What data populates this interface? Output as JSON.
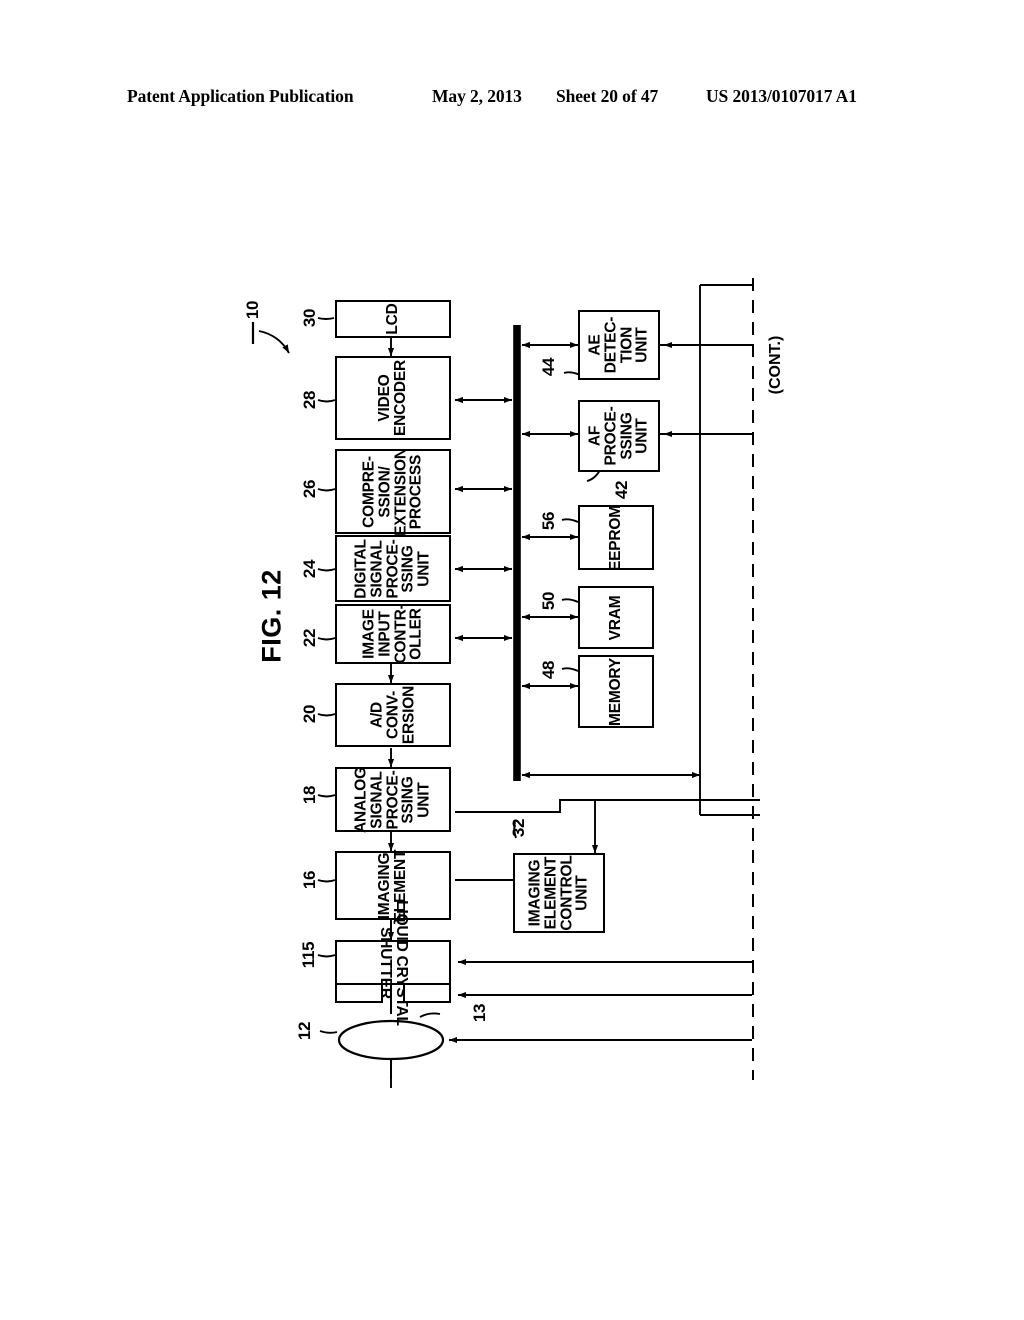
{
  "header": {
    "publication": "Patent Application Publication",
    "date": "May 2, 2013",
    "sheet": "Sheet 20 of 47",
    "doc_number": "US 2013/0107017 A1"
  },
  "figure": {
    "title": "FIG. 12",
    "system_ref": "10",
    "continuation_label": "(CONT.)"
  },
  "blocks": {
    "lcd": {
      "label": "LCD",
      "ref": "30"
    },
    "video_encoder": {
      "label": "VIDEO\nENCODER",
      "ref": "28"
    },
    "compression": {
      "label": "COMPRE-\nSSION/\nEXTENSION\nPROCESS",
      "ref": "26"
    },
    "digital_signal": {
      "label": "DIGITAL\nSIGNAL\nPROCE-\nSSING\nUNIT",
      "ref": "24"
    },
    "image_input": {
      "label": "IMAGE\nINPUT\nCONTR-\nOLLER",
      "ref": "22"
    },
    "ad_conversion": {
      "label": "A/D\nCONV-\nERSION",
      "ref": "20"
    },
    "analog_signal": {
      "label": "ANALOG\nSIGNAL\nPROCE-\nSSING\nUNIT",
      "ref": "18"
    },
    "imaging_element": {
      "label": "IMAGING\nELEMENT",
      "ref": "16"
    },
    "lc_shutter": {
      "label": "LIQUID CRYSTAL\nSHUTTER",
      "ref": "115"
    },
    "lens": {
      "label": "",
      "ref": "12"
    },
    "lens_link": {
      "label": "",
      "ref": "13"
    },
    "ie_control": {
      "label": "IMAGING\nELEMENT\nCONTROL\nUNIT",
      "ref": "32"
    },
    "ae_detection": {
      "label": "AE\nDETEC-\nTION\nUNIT",
      "ref": "44"
    },
    "af_processing": {
      "label": "AF\nPROCE-\nSSING\nUNIT",
      "ref": "42"
    },
    "eeprom": {
      "label": "EEPROM",
      "ref": "56"
    },
    "vram": {
      "label": "VRAM",
      "ref": "50"
    },
    "memory": {
      "label": "MEMORY",
      "ref": "48"
    }
  },
  "colors": {
    "ink": "#000000",
    "paper": "#ffffff"
  }
}
